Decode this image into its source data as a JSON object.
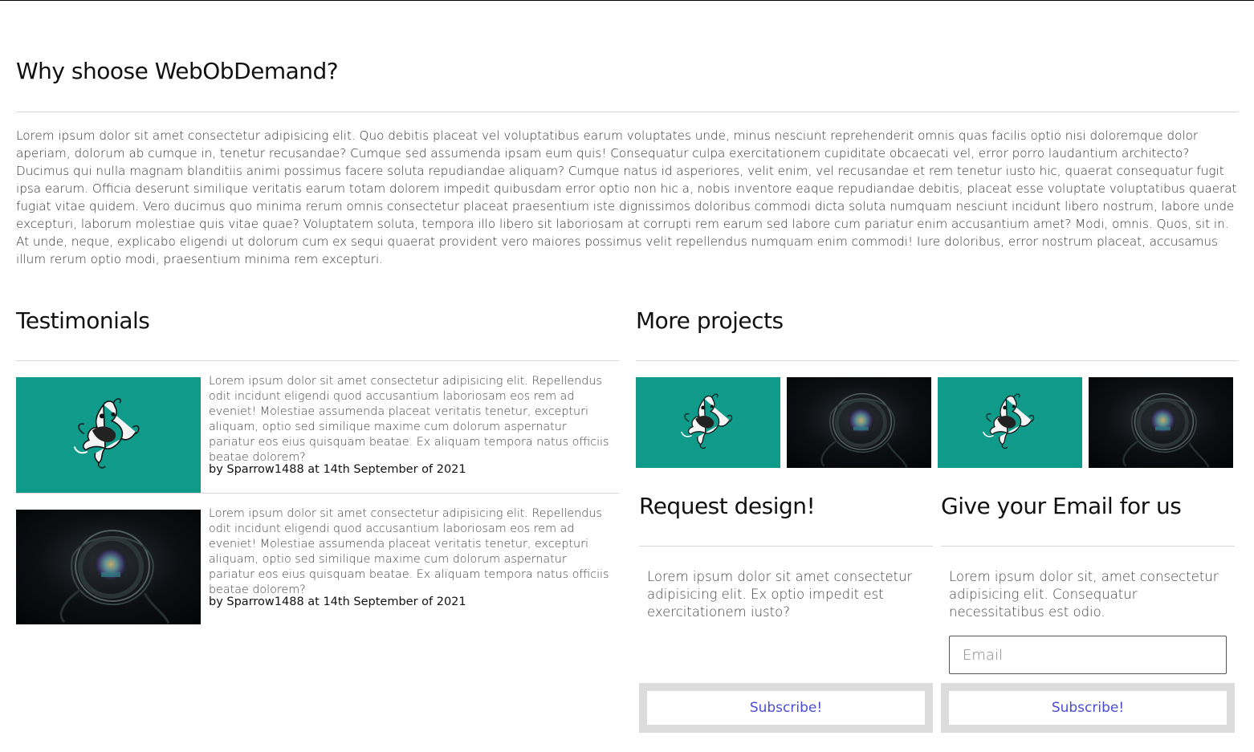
{
  "why": {
    "title": "Why shoose WebObDemand?",
    "text": "Lorem ipsum dolor sit amet consectetur adipisicing elit. Quo debitis placeat vel voluptatibus earum voluptates unde, minus nesciunt reprehenderit omnis quas facilis optio nisi doloremque dolor aperiam, dolorum ab cumque in, tenetur recusandae? Cumque sed assumenda ipsam eum quis! Consequatur culpa exercitationem cupiditate obcaecati vel, error porro laudantium architecto? Ducimus qui nulla magnam blanditiis animi possimus facere soluta repudiandae aliquam? Cumque natus id asperiores, velit enim, vel recusandae et rem tenetur iusto hic, quaerat consequatur fugit ipsa earum. Officia deserunt similique veritatis earum totam dolorem impedit quibusdam error optio non hic a, nobis inventore eaque repudiandae debitis, placeat esse voluptate voluptatibus quaerat fugiat vitae quidem. Vero ducimus quo minima rerum omnis consectetur placeat praesentium iste dignissimos doloribus commodi dicta soluta numquam nesciunt incidunt libero nostrum, labore unde excepturi, laborum molestiae quis vitae quae? Voluptatem soluta, tempora illo libero sit laboriosam at corrupti rem earum sed labore cum pariatur enim accusantium amet? Modi, omnis. Quos, sit in. At unde, neque, explicabo eligendi ut dolorum cum ex sequi quaerat provident vero maiores possimus velit repellendus numquam enim commodi! Iure doloribus, error nostrum placeat, accusamus illum rerum optio modi, praesentium minima rem excepturi."
  },
  "testimonials": {
    "title": "Testimonials",
    "items": [
      {
        "image": "teal-illustration",
        "text": "Lorem ipsum dolor sit amet consectetur adipisicing elit. Repellendus odit incidunt eligendi quod accusantium laboriosam eos rem ad eveniet! Molestiae assumenda placeat veritatis tenetur, excepturi aliquam, optio sed similique maxime cum dolorum aspernatur pariatur eos eius quisquam beatae. Ex aliquam tempora natus officiis beatae dolorem?",
        "byline": "by Sparrow1488 at 14th September of 2021"
      },
      {
        "image": "dark-abstract-render",
        "text": "Lorem ipsum dolor sit amet consectetur adipisicing elit. Repellendus odit incidunt eligendi quod accusantium laboriosam eos rem ad eveniet! Molestiae assumenda placeat veritatis tenetur, excepturi aliquam, optio sed similique maxime cum dolorum aspernatur pariatur eos eius quisquam beatae. Ex aliquam tempora natus officiis beatae dolorem?",
        "byline": "by Sparrow1488 at 14th September of 2021"
      }
    ]
  },
  "projects": {
    "title": "More projects",
    "images": [
      "teal-illustration",
      "dark-abstract-render",
      "teal-illustration",
      "dark-abstract-render"
    ]
  },
  "request": {
    "title": "Request design!",
    "text": "Lorem ipsum dolor sit amet consectetur adipisicing elit. Ex optio impedit est exercitationem iusto?",
    "button": "Subscribe!"
  },
  "email": {
    "title": "Give your Email for us",
    "text": "Lorem ipsum dolor sit, amet consectetur adipisicing elit. Consequatur necessitatibus est odio.",
    "placeholder": "Email",
    "button": "Subscribe!"
  },
  "colors": {
    "teal": "#0f9a8a",
    "button_text": "#4a4cd6",
    "button_frame": "#dcdcdc"
  }
}
